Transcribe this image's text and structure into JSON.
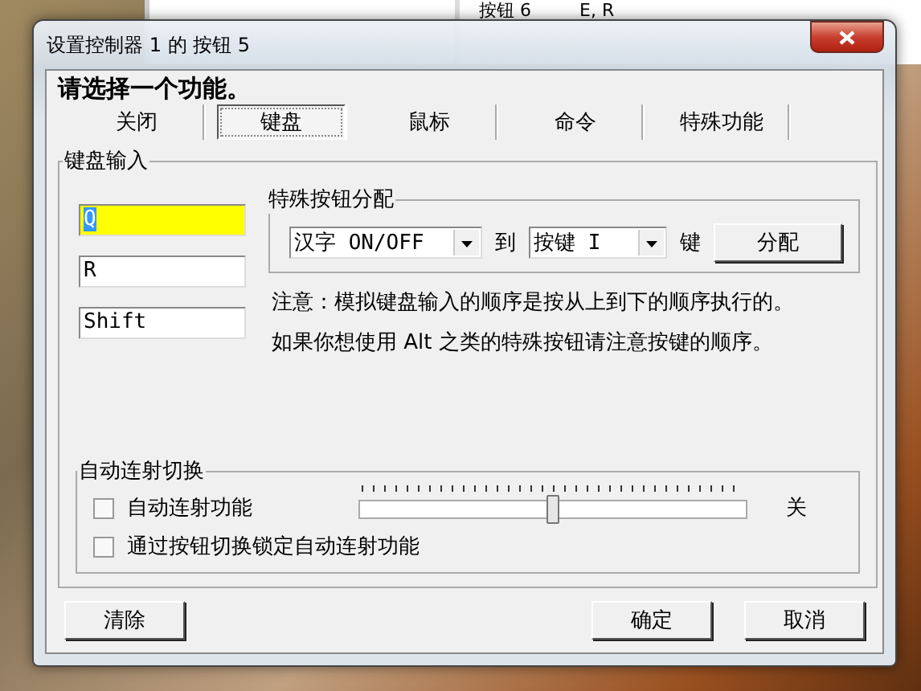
{
  "background_window": {
    "rows": [
      {
        "label": "按钮 6",
        "value": "E, R"
      }
    ]
  },
  "window": {
    "title": "设置控制器 1 的 按钮 5"
  },
  "prompt": "请选择一个功能。",
  "tabs": [
    {
      "label": "关闭",
      "selected": false
    },
    {
      "label": "键盘",
      "selected": true
    },
    {
      "label": "鼠标",
      "selected": false
    },
    {
      "label": "命令",
      "selected": false
    },
    {
      "label": "特殊功能",
      "selected": false
    }
  ],
  "keyboard_input": {
    "title": "键盘输入",
    "keys": [
      {
        "value": "Q",
        "highlighted": true
      },
      {
        "value": "R",
        "highlighted": false
      },
      {
        "value": "Shift",
        "highlighted": false
      }
    ],
    "special_assign": {
      "title": "特殊按钮分配",
      "source": "汉字 ON/OFF",
      "to_label": "到",
      "target": "按键 I",
      "key_label": "键",
      "button": "分配"
    },
    "note": [
      "注意：模拟键盘输入的顺序是按从上到下的顺序执行的。",
      "如果你想使用 Alt 之类的特殊按钮请注意按键的顺序。"
    ]
  },
  "autofire": {
    "title": "自动连射切换",
    "options": [
      {
        "label": "自动连射功能",
        "checked": false
      },
      {
        "label": "通过按钮切换锁定自动连射功能",
        "checked": false
      }
    ],
    "speed": {
      "level": 0.5
    },
    "reading": "关"
  },
  "buttons": {
    "clear": "清除",
    "ok": "确定",
    "cancel": "取消"
  }
}
